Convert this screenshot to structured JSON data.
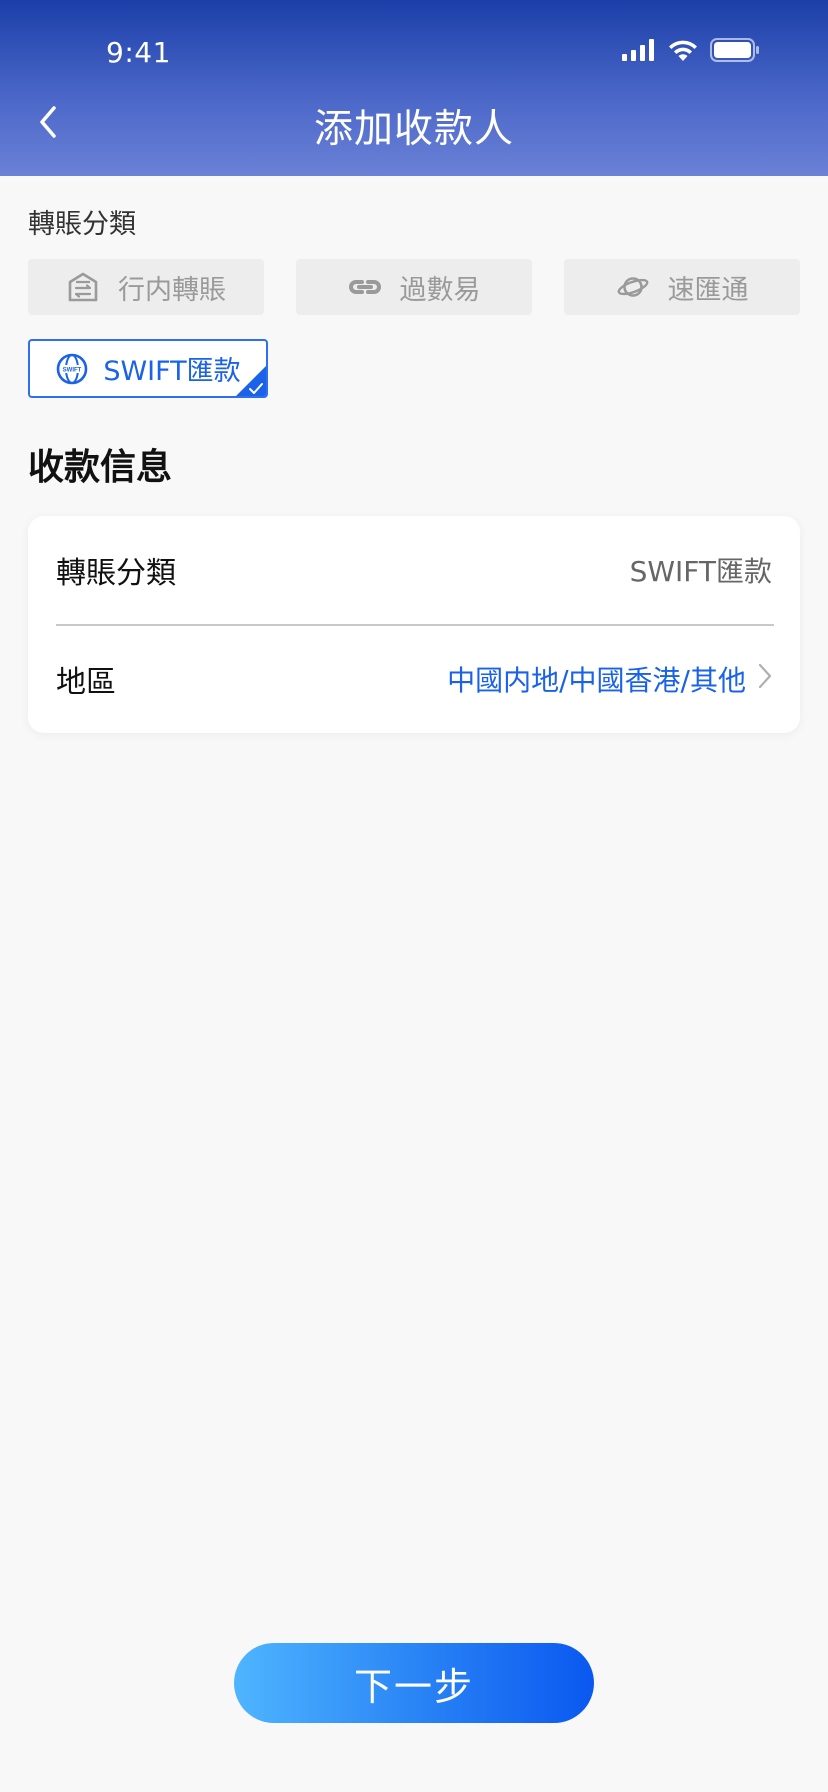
{
  "status_bar": {
    "time": "9:41",
    "icons": [
      "cellular-signal-icon",
      "wifi-icon",
      "battery-icon"
    ]
  },
  "header": {
    "title": "添加收款人",
    "back_icon": "chevron-left-icon"
  },
  "transfer_type": {
    "label": "轉賬分類",
    "options": [
      {
        "label": "行内轉賬",
        "icon": "bank-transfer-icon",
        "selected": false
      },
      {
        "label": "過數易",
        "icon": "link-icon",
        "selected": false
      },
      {
        "label": "速匯通",
        "icon": "planet-icon",
        "selected": false
      },
      {
        "label": "SWIFT匯款",
        "icon": "globe-swift-icon",
        "selected": true
      }
    ]
  },
  "payee_info": {
    "heading": "收款信息",
    "rows": [
      {
        "label": "轉賬分類",
        "value": "SWIFT匯款"
      },
      {
        "label": "地區",
        "value": "中國内地/中國香港/其他"
      }
    ]
  },
  "footer": {
    "next_label": "下一步"
  },
  "colors": {
    "header_gradient_top": "#1b3fa8",
    "header_gradient_bottom": "#6b81d6",
    "accent": "#1a62e8",
    "chip_bg": "#ededee",
    "chip_text": "#9a9a9a",
    "button_gradient_start": "#4fb5ff",
    "button_gradient_end": "#0a58f0"
  }
}
